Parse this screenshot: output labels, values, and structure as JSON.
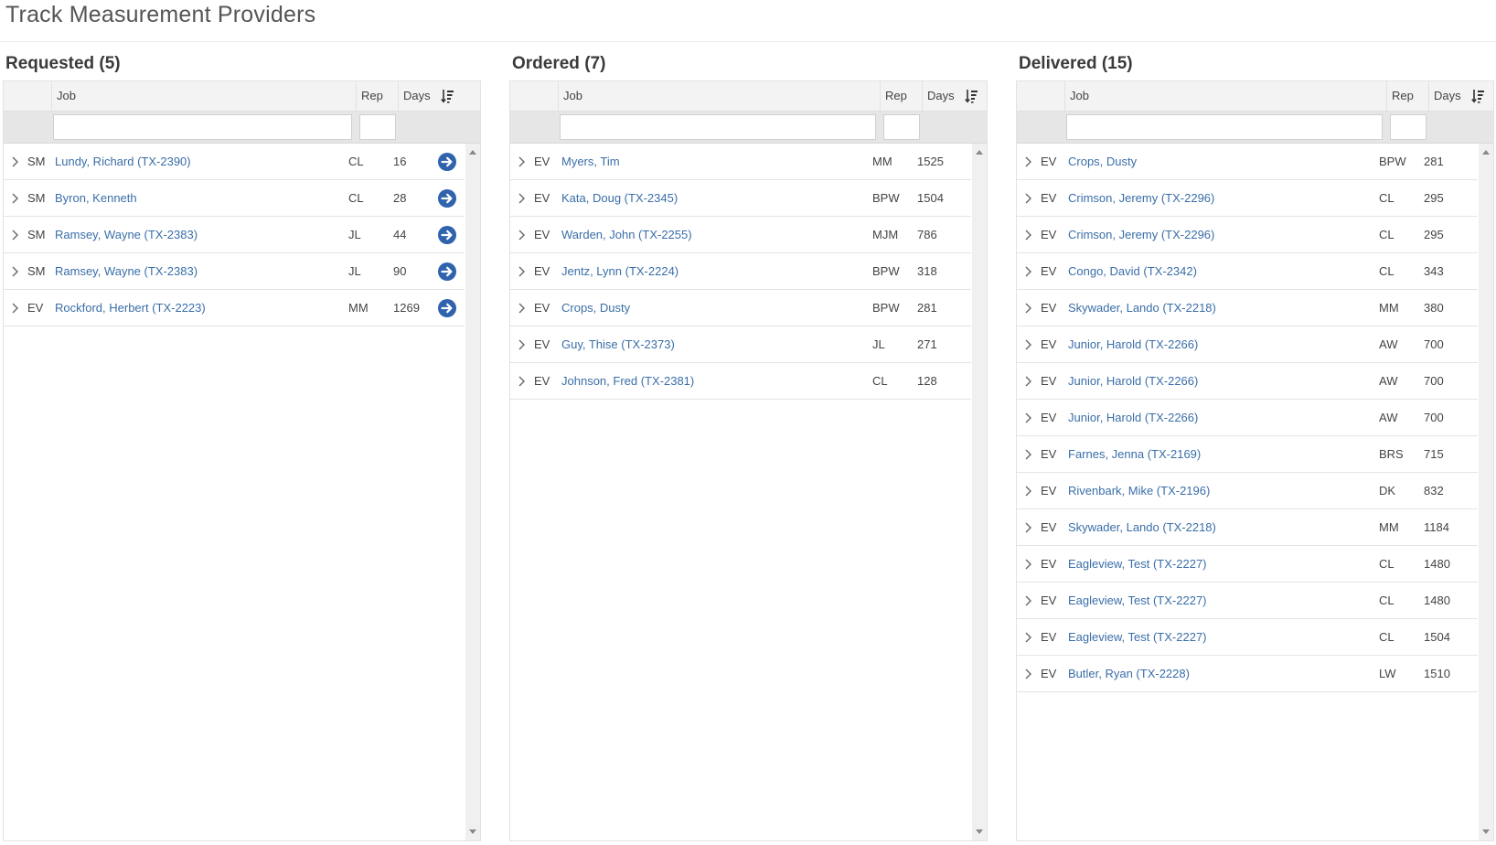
{
  "page": {
    "title": "Track Measurement Providers"
  },
  "colors": {
    "link": "#3a6ea8",
    "accent": "#2f63ad",
    "header_bg": "#f3f3f3",
    "filter_bg": "#e6e6e6"
  },
  "icons": {
    "expand": "chevron-right-icon",
    "go": "arrow-circle-right-icon",
    "sort": "sort-descending-icon"
  },
  "panels": [
    {
      "heading": "Requested (5)",
      "columns": {
        "job": "Job",
        "rep": "Rep",
        "days": "Days"
      },
      "filters": {
        "job": "",
        "rep": ""
      },
      "rows": [
        {
          "src": "SM",
          "job": "Lundy, Richard (TX-2390)",
          "rep": "CL",
          "days": "16"
        },
        {
          "src": "SM",
          "job": "Byron, Kenneth",
          "rep": "CL",
          "days": "28"
        },
        {
          "src": "SM",
          "job": "Ramsey, Wayne (TX-2383)",
          "rep": "JL",
          "days": "44"
        },
        {
          "src": "SM",
          "job": "Ramsey, Wayne (TX-2383)",
          "rep": "JL",
          "days": "90"
        },
        {
          "src": "EV",
          "job": "Rockford, Herbert (TX-2223)",
          "rep": "MM",
          "days": "1269"
        }
      ]
    },
    {
      "heading": "Ordered (7)",
      "columns": {
        "job": "Job",
        "rep": "Rep",
        "days": "Days"
      },
      "filters": {
        "job": "",
        "rep": ""
      },
      "rows": [
        {
          "src": "EV",
          "job": "Myers, Tim",
          "rep": "MM",
          "days": "1525"
        },
        {
          "src": "EV",
          "job": "Kata, Doug (TX-2345)",
          "rep": "BPW",
          "days": "1504"
        },
        {
          "src": "EV",
          "job": "Warden, John (TX-2255)",
          "rep": "MJM",
          "days": "786"
        },
        {
          "src": "EV",
          "job": "Jentz, Lynn (TX-2224)",
          "rep": "BPW",
          "days": "318"
        },
        {
          "src": "EV",
          "job": "Crops, Dusty",
          "rep": "BPW",
          "days": "281"
        },
        {
          "src": "EV",
          "job": "Guy, Thise (TX-2373)",
          "rep": "JL",
          "days": "271"
        },
        {
          "src": "EV",
          "job": "Johnson, Fred (TX-2381)",
          "rep": "CL",
          "days": "128"
        }
      ]
    },
    {
      "heading": "Delivered (15)",
      "columns": {
        "job": "Job",
        "rep": "Rep",
        "days": "Days"
      },
      "filters": {
        "job": "",
        "rep": ""
      },
      "rows": [
        {
          "src": "EV",
          "job": "Crops, Dusty",
          "rep": "BPW",
          "days": "281"
        },
        {
          "src": "EV",
          "job": "Crimson, Jeremy (TX-2296)",
          "rep": "CL",
          "days": "295"
        },
        {
          "src": "EV",
          "job": "Crimson, Jeremy (TX-2296)",
          "rep": "CL",
          "days": "295"
        },
        {
          "src": "EV",
          "job": "Congo, David (TX-2342)",
          "rep": "CL",
          "days": "343"
        },
        {
          "src": "EV",
          "job": "Skywader, Lando (TX-2218)",
          "rep": "MM",
          "days": "380"
        },
        {
          "src": "EV",
          "job": "Junior, Harold (TX-2266)",
          "rep": "AW",
          "days": "700"
        },
        {
          "src": "EV",
          "job": "Junior, Harold (TX-2266)",
          "rep": "AW",
          "days": "700"
        },
        {
          "src": "EV",
          "job": "Junior, Harold (TX-2266)",
          "rep": "AW",
          "days": "700"
        },
        {
          "src": "EV",
          "job": "Farnes, Jenna (TX-2169)",
          "rep": "BRS",
          "days": "715"
        },
        {
          "src": "EV",
          "job": "Rivenbark, Mike (TX-2196)",
          "rep": "DK",
          "days": "832"
        },
        {
          "src": "EV",
          "job": "Skywader, Lando (TX-2218)",
          "rep": "MM",
          "days": "1184"
        },
        {
          "src": "EV",
          "job": "Eagleview, Test (TX-2227)",
          "rep": "CL",
          "days": "1480"
        },
        {
          "src": "EV",
          "job": "Eagleview, Test (TX-2227)",
          "rep": "CL",
          "days": "1480"
        },
        {
          "src": "EV",
          "job": "Eagleview, Test (TX-2227)",
          "rep": "CL",
          "days": "1504"
        },
        {
          "src": "EV",
          "job": "Butler, Ryan (TX-2228)",
          "rep": "LW",
          "days": "1510"
        }
      ]
    }
  ]
}
